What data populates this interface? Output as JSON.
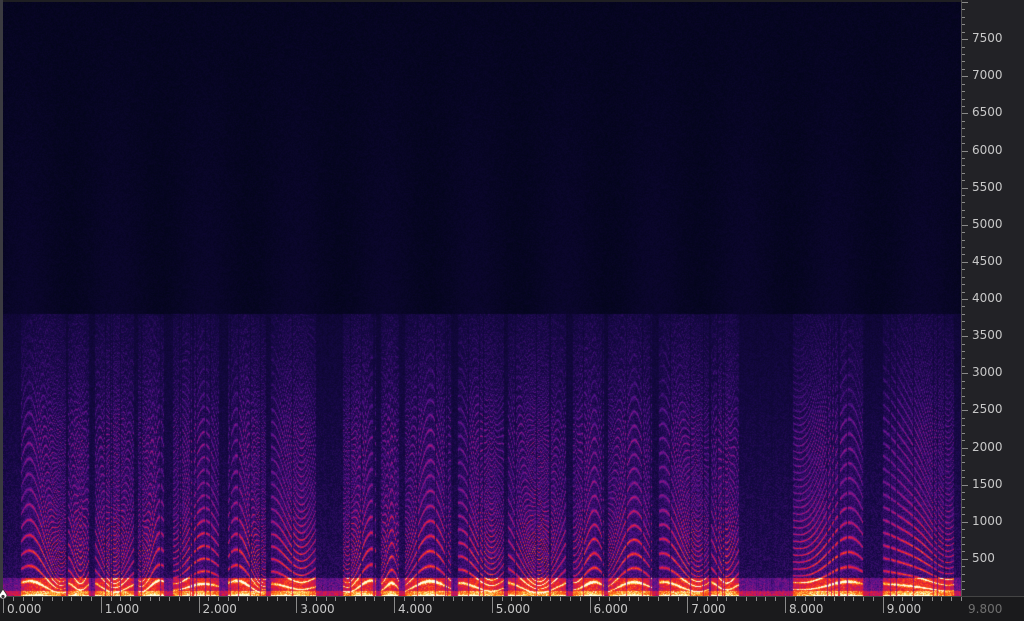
{
  "spectrogram": {
    "duration_s": 9.8,
    "max_freq_hz": 8000,
    "content_ceiling_hz": 3800,
    "colormap": "inferno-like (black-purple-red-yellow)"
  },
  "freq_axis": {
    "labels": [
      "7500",
      "7000",
      "6500",
      "6000",
      "5500",
      "5000",
      "4500",
      "4000",
      "3500",
      "3000",
      "2500",
      "2000",
      "1500",
      "1000",
      "500"
    ]
  },
  "time_axis": {
    "labels": [
      "0.000",
      "1.000",
      "2.000",
      "3.000",
      "4.000",
      "5.000",
      "6.000",
      "7.000",
      "8.000",
      "9.000"
    ],
    "end_label": "9.800"
  },
  "playhead": {
    "icon": "playhead-marker-icon"
  }
}
